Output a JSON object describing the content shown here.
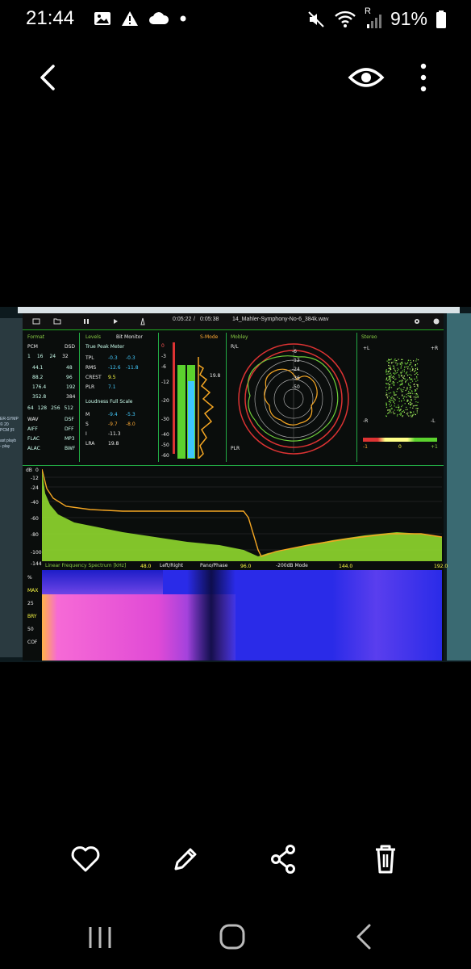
{
  "status_bar": {
    "time": "21:44",
    "battery": "91%",
    "left_icons": [
      "image-icon",
      "warning-icon",
      "cloud-icon",
      "dot-icon"
    ],
    "right_icons": [
      "mute-icon",
      "wifi-icon",
      "signal-icon",
      "battery-icon"
    ],
    "signal_label": "R"
  },
  "top_bar": {
    "back": "back-icon",
    "eye": "eye-icon",
    "more": "more-icon"
  },
  "analyzer": {
    "time_current": "0:05:22",
    "time_separator": "/",
    "time_total": "0:05:38",
    "filename": "14_Mahler-Symphony-No-6_384k.wav",
    "format": {
      "title": "Format",
      "pcm": "PCM",
      "dsd": "DSD",
      "bits": [
        "1",
        "16",
        "24",
        "32"
      ],
      "rates": [
        "44.1",
        "88.2",
        "176.4",
        "352.8"
      ],
      "dsd_rates": [
        "48",
        "96",
        "192",
        "384"
      ],
      "dsd_bits": [
        "64",
        "128",
        "256",
        "512"
      ],
      "containers_left": [
        "WAV",
        "AIFF",
        "FLAC",
        "ALAC"
      ],
      "containers_right": [
        "DSF",
        "DFF",
        "MP3",
        "BWF"
      ]
    },
    "levels": {
      "title": "Levels",
      "bit_monitor": "Bit Monitor",
      "true_peak_meter": "True Peak Meter",
      "rows": [
        {
          "label": "TPL",
          "l": "-0.3",
          "r": "-0.3"
        },
        {
          "label": "RMS",
          "l": "-12.6",
          "r": "-11.8"
        },
        {
          "label": "CREST",
          "l": "9.5",
          "r": ""
        },
        {
          "label": "PLR",
          "l": "7.1",
          "r": ""
        }
      ],
      "loudness": "Loudness Full Scale",
      "loud_rows": [
        {
          "label": "M",
          "l": "-9.4",
          "r": "-5.3"
        },
        {
          "label": "S",
          "l": "-9.7",
          "r": "-8.0"
        },
        {
          "label": "I",
          "l": "-11.3",
          "r": ""
        },
        {
          "label": "LRA",
          "l": "19.8",
          "r": ""
        }
      ]
    },
    "meter": {
      "title": "S-Mode",
      "scale": [
        "0",
        "-3",
        "-6",
        "-12",
        "-20",
        "-30",
        "-40",
        "-50",
        "-60"
      ],
      "peak": "19.8"
    },
    "polar": {
      "title": "Mobley",
      "rl": "R/L",
      "plr": "PLR",
      "rings": [
        "-6",
        "-12",
        "-24",
        "-36",
        "-50"
      ]
    },
    "stereo": {
      "title": "Stereo",
      "l_top": "+L",
      "r_top": "+R",
      "l_bottom": "-R",
      "r_bottom": "-L",
      "scale_left": "-1",
      "scale_mid": "0",
      "scale_right": "+1"
    },
    "spectrum": {
      "db_label": "dB",
      "y_ticks": [
        "0",
        "-12",
        "-24",
        "-40",
        "-60",
        "-80",
        "-100",
        "-144"
      ],
      "title": "Linear Frequency Spectrum [kHz]",
      "x_ticks": [
        "48.0",
        "96.0",
        "144.0",
        "192.0"
      ],
      "modes": [
        "Left/Right",
        "Pano/Phase",
        "-200dB Mode"
      ]
    },
    "spectrogram": {
      "labels": [
        "%",
        "MAX",
        "25",
        "BRY",
        "50",
        "COF"
      ]
    },
    "side_text": [
      "ER-SYMP",
      "© 20",
      "PCM (R",
      "ast playb",
      "- play"
    ]
  },
  "bottom_bar": {
    "icons": [
      "heart-icon",
      "edit-icon",
      "share-icon",
      "delete-icon"
    ]
  },
  "nav_bar": {
    "icons": [
      "recents-icon",
      "home-icon",
      "back-nav-icon"
    ]
  },
  "colors": {
    "background": "#000000",
    "analyzer_green": "#7fd13b",
    "analyzer_orange": "#f5a623",
    "analyzer_cyan": "#3ec6ff",
    "analyzer_red": "#e0403a",
    "spectrogram_blue": "#2a2be8",
    "spectrogram_magenta": "#e04ad6"
  }
}
